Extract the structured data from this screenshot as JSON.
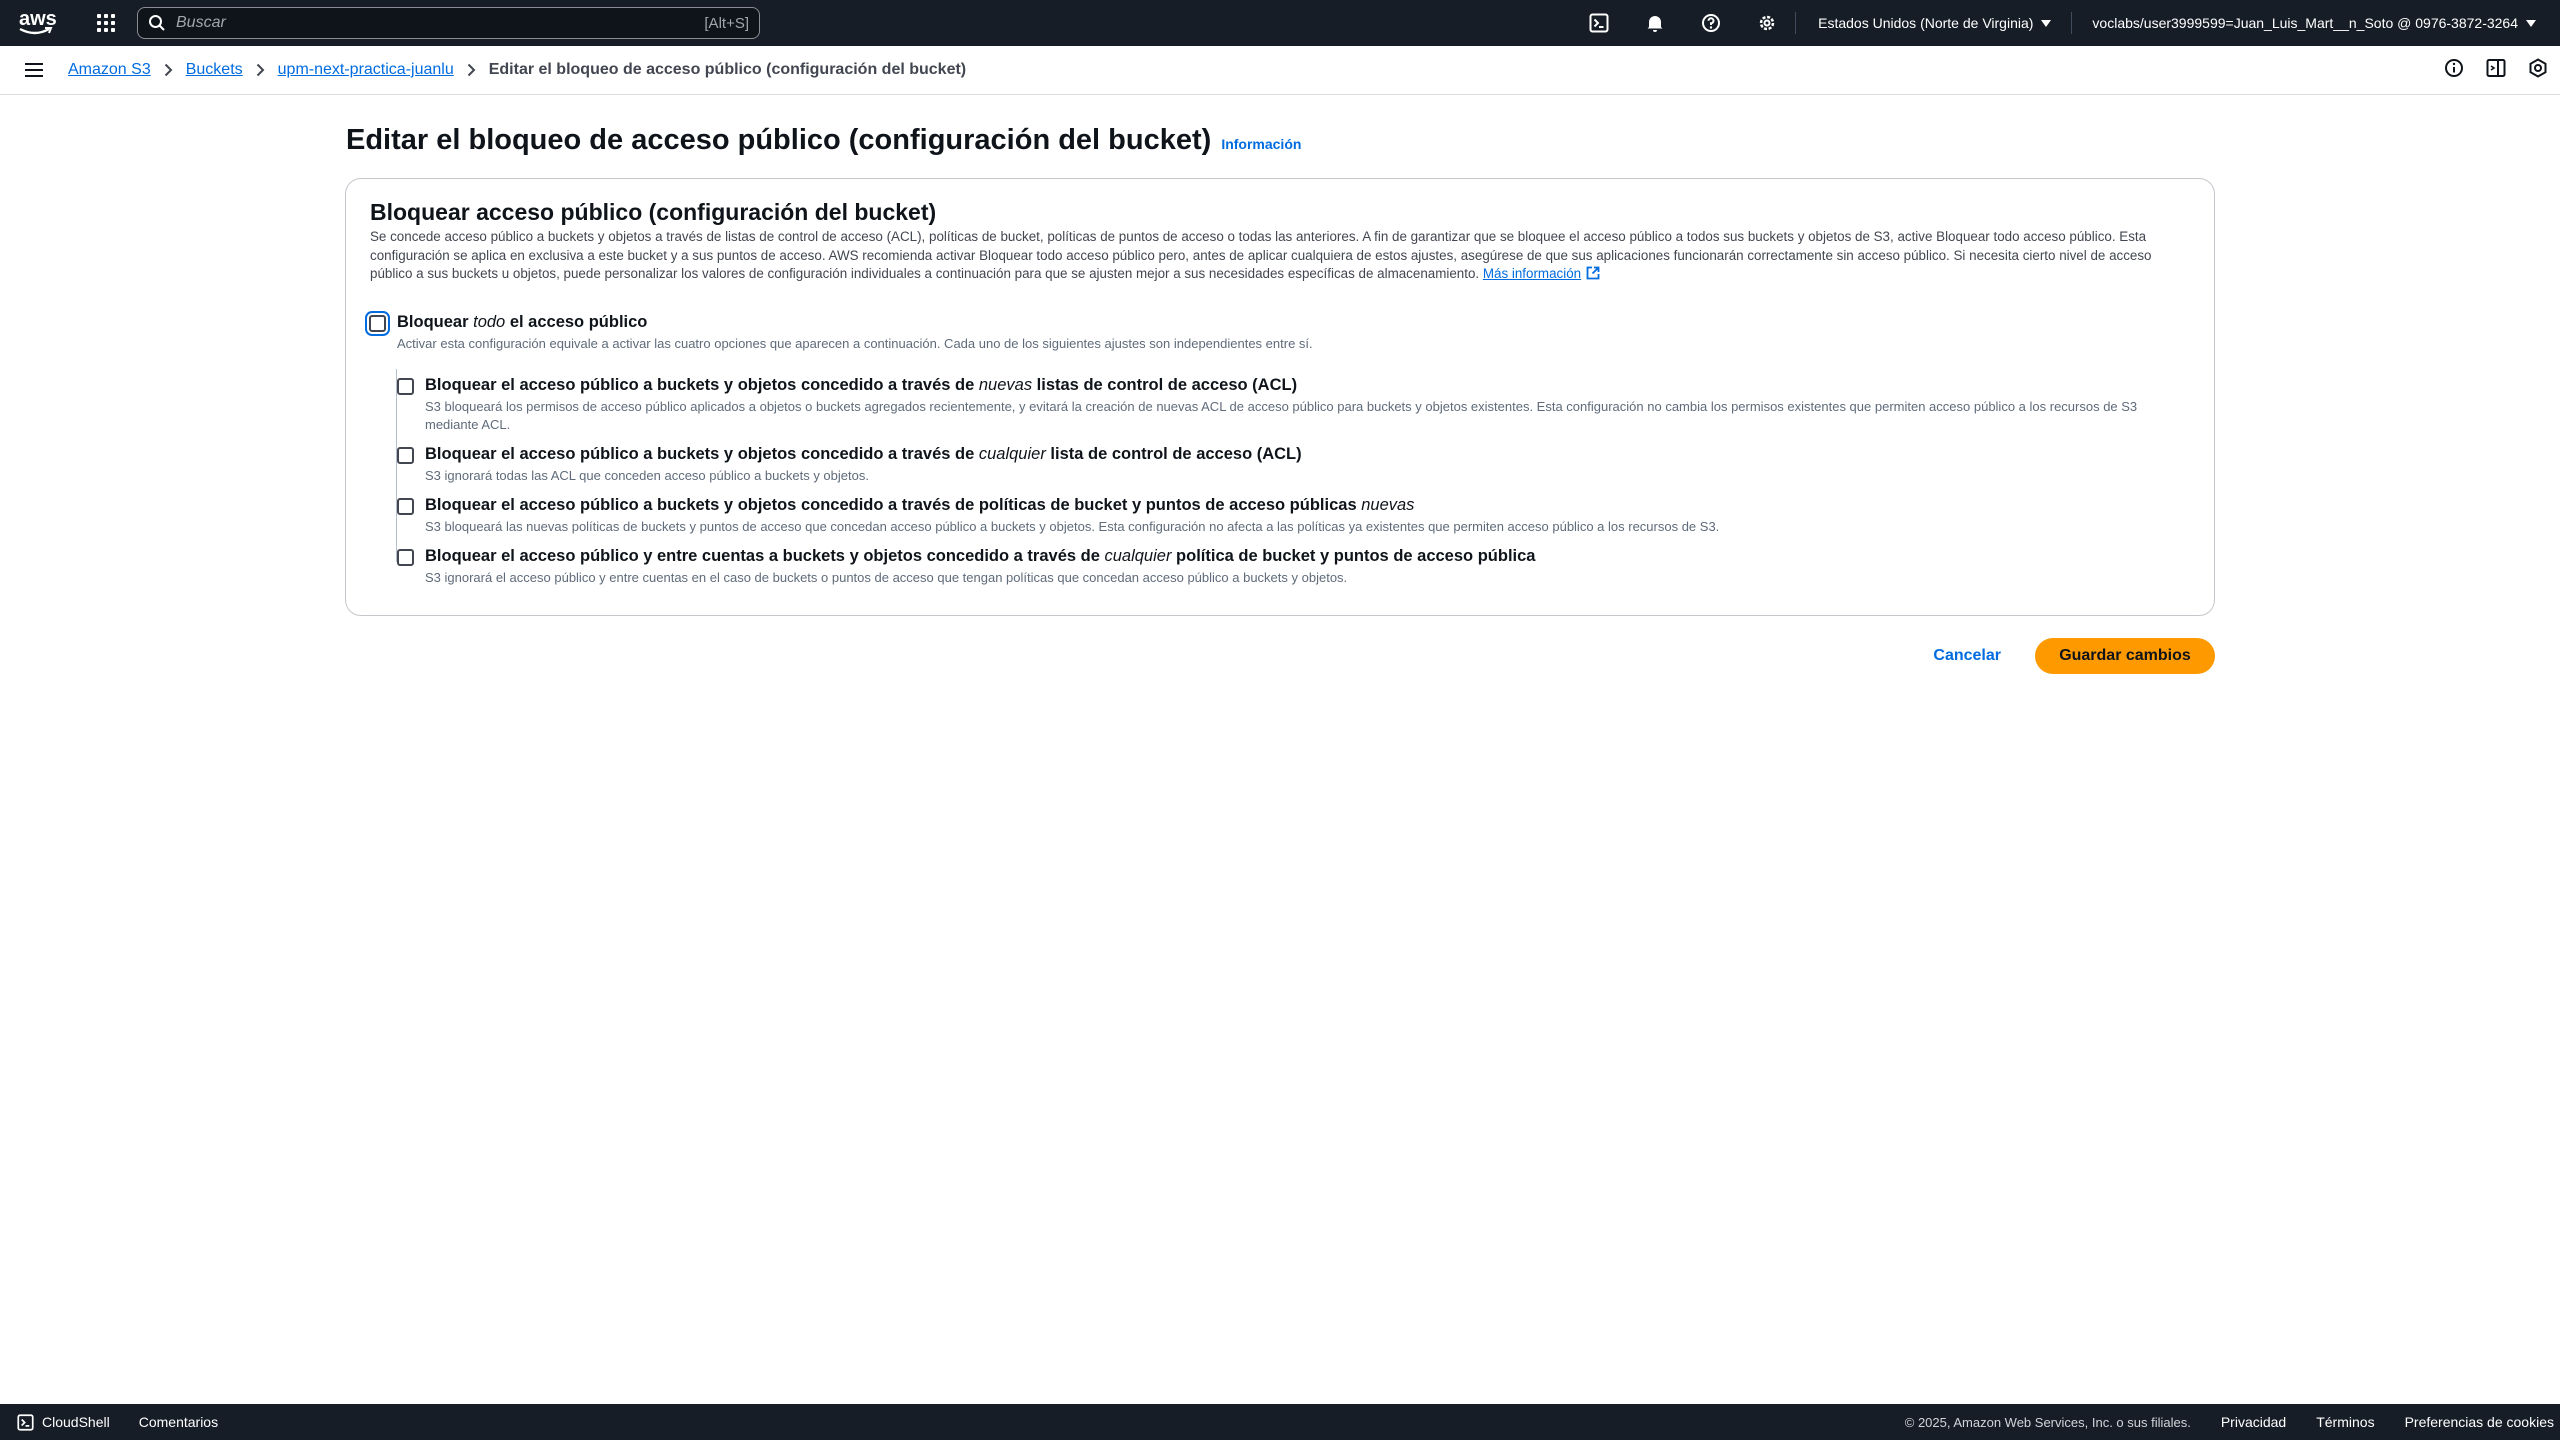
{
  "topnav": {
    "logo_text": "aws",
    "search_placeholder": "Buscar",
    "search_shortcut": "[Alt+S]",
    "region": "Estados Unidos (Norte de Virginia)",
    "account": "voclabs/user3999599=Juan_Luis_Mart__n_Soto @ 0976-3872-3264"
  },
  "breadcrumb": {
    "items": [
      "Amazon S3",
      "Buckets",
      "upm-next-practica-juanlu"
    ],
    "current": "Editar el bloqueo de acceso público (configuración del bucket)"
  },
  "page": {
    "title": "Editar el bloqueo de acceso público (configuración del bucket)",
    "info_link": "Información"
  },
  "panel": {
    "title": "Bloquear acceso público (configuración del bucket)",
    "description": "Se concede acceso público a buckets y objetos a través de listas de control de acceso (ACL), políticas de bucket, políticas de puntos de acceso o todas las anteriores. A fin de garantizar que se bloquee el acceso público a todos sus buckets y objetos de S3, active Bloquear todo acceso público. Esta configuración se aplica en exclusiva a este bucket y a sus puntos de acceso. AWS recomienda activar Bloquear todo acceso público pero, antes de aplicar cualquiera de estos ajustes, asegúrese de que sus aplicaciones funcionarán correctamente sin acceso público. Si necesita cierto nivel de acceso público a sus buckets u objetos, puede personalizar los valores de configuración individuales a continuación para que se ajusten mejor a sus necesidades específicas de almacenamiento.",
    "more_info_link": "Más información",
    "block_all": {
      "label_pre": "Bloquear ",
      "label_em": "todo",
      "label_post": " el acceso público",
      "desc": "Activar esta configuración equivale a activar las cuatro opciones que aparecen a continuación. Cada uno de los siguientes ajustes son independientes entre sí.",
      "checked": false
    },
    "options": [
      {
        "label_pre": "Bloquear el acceso público a buckets y objetos concedido a través de ",
        "label_em": "nuevas",
        "label_post": " listas de control de acceso (ACL)",
        "desc": "S3 bloqueará los permisos de acceso público aplicados a objetos o buckets agregados recientemente, y evitará la creación de nuevas ACL de acceso público para buckets y objetos existentes. Esta configuración no cambia los permisos existentes que permiten acceso público a los recursos de S3 mediante ACL.",
        "checked": false
      },
      {
        "label_pre": "Bloquear el acceso público a buckets y objetos concedido a través de ",
        "label_em": "cualquier",
        "label_post": " lista de control de acceso (ACL)",
        "desc": "S3 ignorará todas las ACL que conceden acceso público a buckets y objetos.",
        "checked": false
      },
      {
        "label_pre": "Bloquear el acceso público a buckets y objetos concedido a través de políticas de bucket y puntos de acceso públicas ",
        "label_em": "nuevas",
        "label_post": "",
        "desc": "S3 bloqueará las nuevas políticas de buckets y puntos de acceso que concedan acceso público a buckets y objetos. Esta configuración no afecta a las políticas ya existentes que permiten acceso público a los recursos de S3.",
        "checked": false
      },
      {
        "label_pre": "Bloquear el acceso público y entre cuentas a buckets y objetos concedido a través de ",
        "label_em": "cualquier",
        "label_post": " política de bucket y puntos de acceso pública",
        "desc": "S3 ignorará el acceso público y entre cuentas en el caso de buckets o puntos de acceso que tengan políticas que concedan acceso público a buckets y objetos.",
        "checked": false
      }
    ]
  },
  "actions": {
    "cancel": "Cancelar",
    "save": "Guardar cambios"
  },
  "footer": {
    "cloudshell": "CloudShell",
    "feedback": "Comentarios",
    "copyright": "© 2025, Amazon Web Services, Inc. o sus filiales.",
    "privacy": "Privacidad",
    "terms": "Términos",
    "cookies": "Preferencias de cookies"
  },
  "colors": {
    "nav_bg": "#161d26",
    "link": "#006ce0",
    "primary_button": "#ff9900",
    "text": "#0f141a"
  }
}
